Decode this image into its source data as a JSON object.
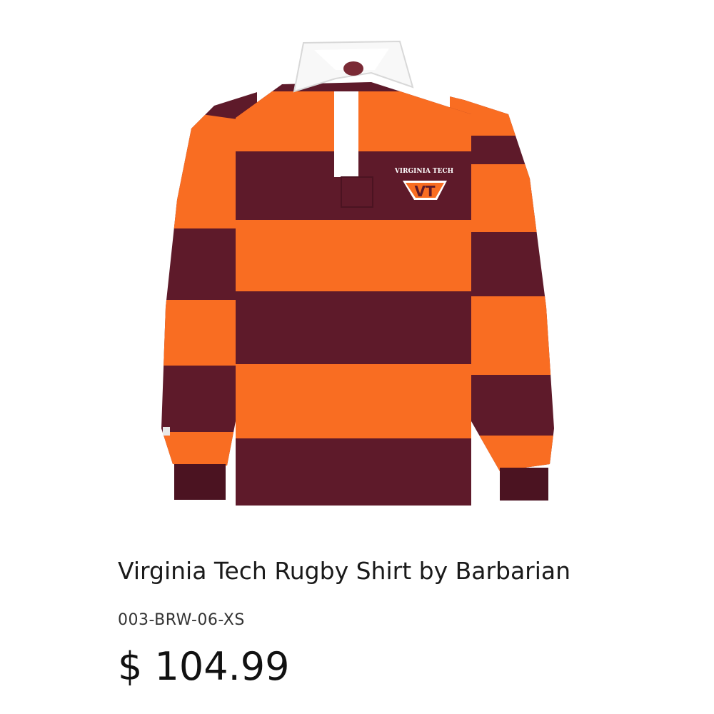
{
  "product": {
    "image_name": "rugby-shirt-image",
    "embroidery_text": "VIRGINIA TECH",
    "logo_text": "VT",
    "title": "Virginia Tech Rugby Shirt by Barbarian",
    "sku": "003-BRW-06-XS",
    "price": "$ 104.99"
  },
  "colors": {
    "orange": "#F96D22",
    "maroon": "#5E1A2A",
    "maroon_dark": "#4B1321",
    "collar": "#F8F8F8"
  }
}
